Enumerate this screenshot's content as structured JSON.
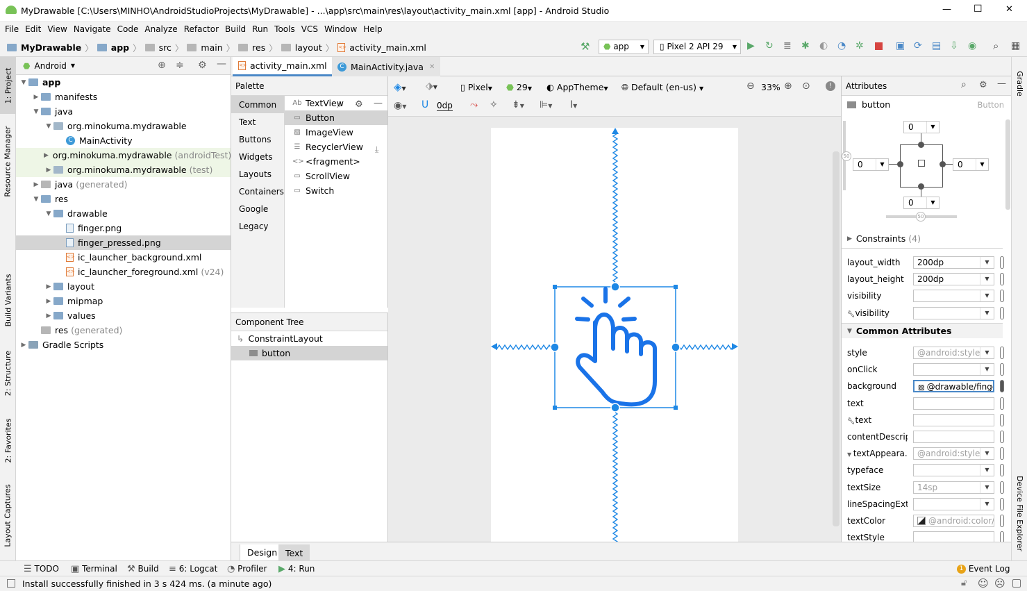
{
  "window": {
    "title": "MyDrawable [C:\\Users\\MINHO\\AndroidStudioProjects\\MyDrawable] - ...\\app\\src\\main\\res\\layout\\activity_main.xml [app] - Android Studio",
    "minimize": "—",
    "maximize": "☐",
    "close": "✕"
  },
  "menu": [
    "File",
    "Edit",
    "View",
    "Navigate",
    "Code",
    "Analyze",
    "Refactor",
    "Build",
    "Run",
    "Tools",
    "VCS",
    "Window",
    "Help"
  ],
  "breadcrumb": [
    "MyDrawable",
    "app",
    "src",
    "main",
    "res",
    "layout",
    "activity_main.xml"
  ],
  "run_toolbar": {
    "config": "app",
    "device": "Pixel 2 API 29"
  },
  "left_tool_tabs": [
    "1: Project",
    "Resource Manager",
    "Build Variants",
    "2: Structure",
    "2: Favorites",
    "Layout Captures"
  ],
  "right_tool_tabs": [
    "Gradle",
    "Device File Explorer"
  ],
  "project": {
    "view_mode": "Android",
    "tree": [
      {
        "label": "app",
        "suffix": "",
        "level": 0,
        "kind": "folder",
        "open": true
      },
      {
        "label": "manifests",
        "suffix": "",
        "level": 1,
        "kind": "folder",
        "open": false
      },
      {
        "label": "java",
        "suffix": "",
        "level": 1,
        "kind": "folder",
        "open": true
      },
      {
        "label": "org.minokuma.mydrawable",
        "suffix": "",
        "level": 2,
        "kind": "pkg",
        "open": true
      },
      {
        "label": "MainActivity",
        "suffix": "",
        "level": 3,
        "kind": "class",
        "open": null
      },
      {
        "label": "org.minokuma.mydrawable",
        "suffix": "(androidTest)",
        "level": 2,
        "kind": "pkg",
        "open": false,
        "tint": "green"
      },
      {
        "label": "org.minokuma.mydrawable",
        "suffix": "(test)",
        "level": 2,
        "kind": "pkg",
        "open": false,
        "tint": "green"
      },
      {
        "label": "java",
        "suffix": "(generated)",
        "level": 1,
        "kind": "gray",
        "open": false
      },
      {
        "label": "res",
        "suffix": "",
        "level": 1,
        "kind": "folder",
        "open": true
      },
      {
        "label": "drawable",
        "suffix": "",
        "level": 2,
        "kind": "folder",
        "open": true
      },
      {
        "label": "finger.png",
        "suffix": "",
        "level": 3,
        "kind": "file",
        "open": null
      },
      {
        "label": "finger_pressed.png",
        "suffix": "",
        "level": 3,
        "kind": "file",
        "open": null,
        "selected": true
      },
      {
        "label": "ic_launcher_background.xml",
        "suffix": "",
        "level": 3,
        "kind": "xml",
        "open": null
      },
      {
        "label": "ic_launcher_foreground.xml",
        "suffix": "(v24)",
        "level": 3,
        "kind": "xml",
        "open": null
      },
      {
        "label": "layout",
        "suffix": "",
        "level": 2,
        "kind": "folder",
        "open": false
      },
      {
        "label": "mipmap",
        "suffix": "",
        "level": 2,
        "kind": "folder",
        "open": false
      },
      {
        "label": "values",
        "suffix": "",
        "level": 2,
        "kind": "folder",
        "open": false
      },
      {
        "label": "res",
        "suffix": "(generated)",
        "level": 1,
        "kind": "gray",
        "open": null
      },
      {
        "label": "Gradle Scripts",
        "suffix": "",
        "level": 0,
        "kind": "gradle",
        "open": false
      }
    ]
  },
  "editor_tabs": [
    {
      "label": "activity_main.xml",
      "active": true
    },
    {
      "label": "MainActivity.java",
      "active": false
    }
  ],
  "palette": {
    "title": "Palette",
    "categories": [
      "Common",
      "Text",
      "Buttons",
      "Widgets",
      "Layouts",
      "Containers",
      "Google",
      "Legacy"
    ],
    "items": [
      {
        "icon": "Ab",
        "label": "TextView"
      },
      {
        "icon": "▭",
        "label": "Button",
        "selected": true
      },
      {
        "icon": "▨",
        "label": "ImageView"
      },
      {
        "icon": "☰",
        "label": "RecyclerView"
      },
      {
        "icon": "<>",
        "label": "<fragment>"
      },
      {
        "icon": "▭",
        "label": "ScrollView"
      },
      {
        "icon": "▭",
        "label": "Switch"
      }
    ]
  },
  "component_tree": {
    "title": "Component Tree",
    "items": [
      {
        "label": "ConstraintLayout",
        "level": 0
      },
      {
        "label": "button",
        "level": 1,
        "selected": true
      }
    ]
  },
  "design_toolbar": {
    "device": "Pixel",
    "api": "29",
    "theme": "AppTheme",
    "locale": "Default (en-us)",
    "zoom": "33%",
    "margin": "0dp"
  },
  "attributes": {
    "title": "Attributes",
    "component_id": "button",
    "component_type": "Button",
    "margins": {
      "top": "0",
      "left": "0",
      "right": "0",
      "bottom": "0"
    },
    "bias_h": "50",
    "bias_v": "50",
    "constraints_label": "Constraints",
    "constraints_count": "(4)",
    "declared": [
      {
        "label": "layout_width",
        "value": "200dp",
        "gray": false
      },
      {
        "label": "layout_height",
        "value": "200dp",
        "gray": false
      },
      {
        "label": "visibility",
        "value": "",
        "gray": false
      },
      {
        "label": "visibility",
        "value": "",
        "gray": false,
        "tool": true
      }
    ],
    "common_header": "Common Attributes",
    "common": [
      {
        "label": "style",
        "value": "@android:style",
        "gray": true,
        "dd": true
      },
      {
        "label": "onClick",
        "value": "",
        "gray": false,
        "dd": true
      },
      {
        "label": "background",
        "value": "@drawable/finger",
        "gray": false,
        "dd": false,
        "focused": true
      },
      {
        "label": "text",
        "value": "",
        "gray": false,
        "dd": false
      },
      {
        "label": "text",
        "value": "",
        "gray": false,
        "dd": false,
        "tool": true
      },
      {
        "label": "contentDescrip...",
        "value": "",
        "gray": false,
        "dd": false
      },
      {
        "label": "textAppeara...",
        "value": "@android:style",
        "gray": true,
        "dd": true,
        "expand": true
      },
      {
        "label": "typeface",
        "value": "",
        "gray": false,
        "dd": true
      },
      {
        "label": "textSize",
        "value": "14sp",
        "gray": true,
        "dd": true
      },
      {
        "label": "lineSpacingExtra",
        "value": "",
        "gray": false,
        "dd": true
      },
      {
        "label": "textColor",
        "value": "@android:color/te",
        "gray": true,
        "dd": false,
        "swatch": true
      },
      {
        "label": "textStyle",
        "value": "",
        "gray": false,
        "dd": false
      }
    ]
  },
  "bottom_editor_tabs": [
    {
      "label": "Design",
      "active": true
    },
    {
      "label": "Text",
      "active": false
    }
  ],
  "tool_buttons": [
    {
      "icon": "☰",
      "label": "TODO"
    },
    {
      "icon": "▣",
      "label": "Terminal"
    },
    {
      "icon": "⚒",
      "label": "Build"
    },
    {
      "icon": "≡",
      "label": "6: Logcat"
    },
    {
      "icon": "◔",
      "label": "Profiler"
    },
    {
      "icon": "▶",
      "label": "4: Run"
    }
  ],
  "event_log": {
    "badge": "1",
    "label": "Event Log"
  },
  "status": {
    "message": "Install successfully finished in 3 s 424 ms. (a minute ago)"
  },
  "colors": {
    "accent": "#1a73e8",
    "selection": "#d4d4d4",
    "blueprint": "#1e88e5"
  }
}
